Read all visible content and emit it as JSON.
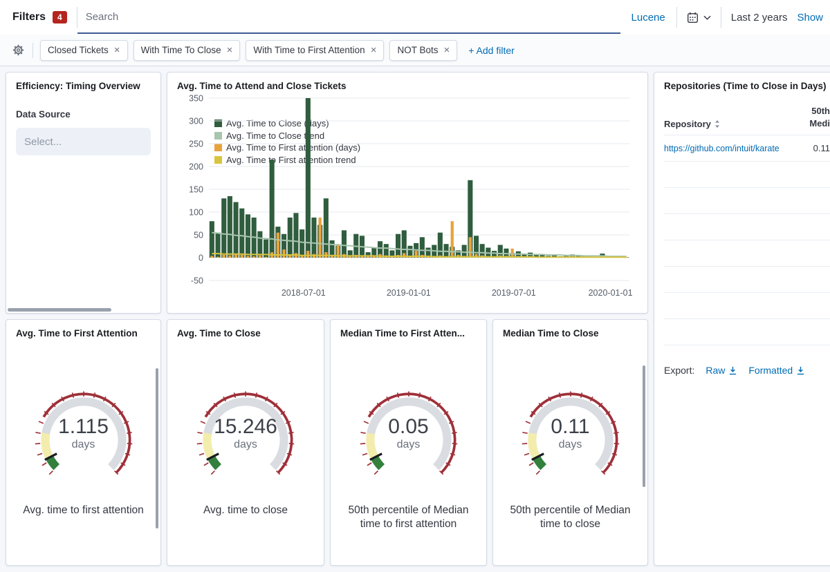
{
  "topbar": {
    "filters_label": "Filters",
    "filters_count": "4",
    "search_placeholder": "Search",
    "query_language": "Lucene",
    "time_range": "Last 2 years",
    "show_dates_label": "Show"
  },
  "filter_bar": {
    "pills": [
      {
        "label": "Closed Tickets"
      },
      {
        "label": "With Time To Close"
      },
      {
        "label": "With Time to First Attention"
      },
      {
        "label": "NOT Bots"
      }
    ],
    "add_filter": "+ Add filter"
  },
  "panels": {
    "timing_overview": {
      "title": "Efficiency: Timing Overview",
      "data_source_label": "Data Source",
      "select_placeholder": "Select..."
    },
    "attend_close_chart": {
      "title": "Avg. Time to Attend and Close Tickets"
    },
    "repositories": {
      "title": "Repositories (Time to Close in Days)",
      "col_repository": "Repository",
      "col_value_line1": "50th",
      "col_value_line2": "Medi",
      "rows": [
        {
          "repository": "https://github.com/intuit/karate",
          "value": "0.11"
        }
      ],
      "empty_row_count": 7,
      "export_label": "Export:",
      "export_raw": "Raw",
      "export_formatted": "Formatted"
    },
    "gauges": [
      {
        "title": "Avg. Time to First Attention",
        "value": "1.115",
        "unit": "days",
        "caption": "Avg. time to first attention"
      },
      {
        "title": "Avg. Time to Close",
        "value": "15.246",
        "unit": "days",
        "caption": "Avg. time to close"
      },
      {
        "title": "Median Time to First Atten...",
        "value": "0.05",
        "unit": "days",
        "caption": "50th percentile of Median time to first attention"
      },
      {
        "title": "Median Time to Close",
        "value": "0.11",
        "unit": "days",
        "caption": "50th percentile of Median time to close"
      }
    ]
  },
  "colors": {
    "link_blue": "#006BB4",
    "badge_red": "#b4251d",
    "text_dark": "#343741",
    "text_gray": "#69707d",
    "border": "#d3dae6",
    "page_bg": "#f5f7fa",
    "search_underline": "#3d5a96",
    "gauge": {
      "ring": "#d9dce1",
      "green": "#33803d",
      "yellow": "#f3edad",
      "red": "#9e3039",
      "needle": "#1a1c21"
    }
  },
  "chart_data": {
    "type": "bar",
    "title": "Avg. Time to Attend and Close Tickets",
    "xlabel": "",
    "ylabel": "",
    "ylim": [
      -50,
      350
    ],
    "y_ticks": [
      -50,
      0,
      50,
      100,
      150,
      200,
      250,
      300,
      350
    ],
    "grid": true,
    "legend_position": "top-left inside plot",
    "x_tick_labels": [
      "2018-07-01",
      "2019-01-01",
      "2019-07-01",
      "2020-01-01"
    ],
    "x_tick_fractions": [
      0.225,
      0.475,
      0.725,
      0.955
    ],
    "series": [
      {
        "name": "Avg. Time to Close (days)",
        "type": "bar",
        "color": "#2f5d3e",
        "values": [
          80,
          55,
          130,
          135,
          122,
          108,
          95,
          88,
          58,
          40,
          215,
          68,
          52,
          88,
          98,
          62,
          350,
          88,
          72,
          130,
          38,
          26,
          60,
          16,
          52,
          48,
          12,
          22,
          36,
          30,
          16,
          52,
          60,
          26,
          32,
          45,
          22,
          28,
          55,
          30,
          24,
          16,
          28,
          170,
          48,
          30,
          22,
          15,
          28,
          20,
          10,
          14,
          8,
          11,
          6,
          8,
          4,
          6,
          3,
          5,
          7,
          4,
          3,
          4,
          2,
          9,
          3,
          2,
          2,
          1
        ]
      },
      {
        "name": "Avg. Time to Close trend",
        "type": "line",
        "color": "#a8c5ad",
        "values": [
          55,
          54,
          52,
          51,
          49,
          48,
          46,
          45,
          43,
          42,
          41,
          39,
          38,
          37,
          36,
          34,
          33,
          32,
          31,
          30,
          29,
          28,
          27,
          26,
          25,
          24,
          23,
          22,
          21,
          21,
          20,
          19,
          18,
          18,
          17,
          16,
          16,
          15,
          14,
          14,
          13,
          13,
          12,
          12,
          11,
          11,
          10,
          10,
          9,
          9,
          8,
          8,
          8,
          7,
          7,
          7,
          6,
          6,
          6,
          5,
          5,
          5,
          4,
          4,
          4,
          4,
          3,
          3,
          3,
          3
        ]
      },
      {
        "name": "Avg. Time to First attention (days)",
        "type": "bar",
        "color": "#e8a33d",
        "values": [
          4,
          2,
          6,
          5,
          8,
          6,
          4,
          3,
          5,
          2,
          12,
          55,
          18,
          6,
          10,
          5,
          15,
          8,
          88,
          12,
          6,
          30,
          8,
          4,
          6,
          5,
          3,
          4,
          8,
          5,
          3,
          6,
          10,
          4,
          15,
          6,
          3,
          4,
          5,
          3,
          80,
          6,
          4,
          45,
          8,
          5,
          3,
          3,
          5,
          4,
          20,
          3,
          2,
          3,
          2,
          2,
          1,
          2,
          1,
          2,
          3,
          1,
          1,
          2,
          1,
          2,
          1,
          1,
          1,
          1
        ]
      },
      {
        "name": "Avg. Time to First attention trend",
        "type": "line",
        "color": "#d9c43e",
        "values": [
          9,
          9,
          8,
          8,
          8,
          8,
          7,
          7,
          7,
          7,
          6,
          6,
          6,
          6,
          6,
          5,
          5,
          5,
          5,
          5,
          5,
          4,
          4,
          4,
          4,
          4,
          4,
          4,
          3,
          3,
          3,
          3,
          3,
          3,
          3,
          3,
          3,
          2,
          2,
          2,
          2,
          2,
          2,
          2,
          2,
          2,
          2,
          2,
          2,
          2,
          2,
          2,
          2,
          2,
          1,
          1,
          1,
          1,
          1,
          1,
          1,
          1,
          1,
          1,
          1,
          1,
          1,
          1,
          1,
          1
        ]
      }
    ]
  }
}
